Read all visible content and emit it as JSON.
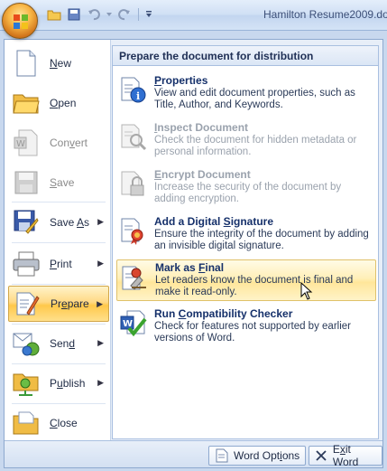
{
  "window": {
    "document_title": "Hamilton Resume2009.do"
  },
  "quick_access": {
    "icons": [
      "open-folder-icon",
      "save-icon",
      "undo-icon",
      "dropdown-icon",
      "redo-icon",
      "customize-icon"
    ]
  },
  "office_menu": {
    "commands": [
      {
        "key": "new",
        "label": "New",
        "accel": "N",
        "icon": "new-document-icon",
        "enabled": true,
        "submenu": false
      },
      {
        "key": "open",
        "label": "Open",
        "accel": "O",
        "icon": "open-folder-icon",
        "enabled": true,
        "submenu": false
      },
      {
        "key": "convert",
        "label": "Convert",
        "accel": "v",
        "icon": "convert-icon",
        "enabled": false,
        "submenu": false
      },
      {
        "key": "save",
        "label": "Save",
        "accel": "S",
        "icon": "save-icon",
        "enabled": false,
        "submenu": false
      },
      {
        "key": "save-as",
        "label": "Save As",
        "accel": "A",
        "icon": "save-as-icon",
        "enabled": true,
        "submenu": true
      },
      {
        "key": "print",
        "label": "Print",
        "accel": "P",
        "icon": "printer-icon",
        "enabled": true,
        "submenu": true
      },
      {
        "key": "prepare",
        "label": "Prepare",
        "accel": "E",
        "icon": "prepare-icon",
        "enabled": true,
        "submenu": true,
        "active": true
      },
      {
        "key": "send",
        "label": "Send",
        "accel": "D",
        "icon": "send-icon",
        "enabled": true,
        "submenu": true
      },
      {
        "key": "publish",
        "label": "Publish",
        "accel": "U",
        "icon": "publish-icon",
        "enabled": true,
        "submenu": true
      },
      {
        "key": "close",
        "label": "Close",
        "accel": "C",
        "icon": "close-folder-icon",
        "enabled": true,
        "submenu": false
      }
    ],
    "label_parts": {
      "new": {
        "pre": "",
        "u": "N",
        "post": "ew"
      },
      "open": {
        "pre": "",
        "u": "O",
        "post": "pen"
      },
      "convert": {
        "pre": "Con",
        "u": "v",
        "post": "ert"
      },
      "save": {
        "pre": "",
        "u": "S",
        "post": "ave"
      },
      "save_as": {
        "pre": "Save ",
        "u": "A",
        "post": "s"
      },
      "print": {
        "pre": "",
        "u": "P",
        "post": "rint"
      },
      "prepare": {
        "pre": "Pr",
        "u": "e",
        "post": "pare"
      },
      "send": {
        "pre": "Sen",
        "u": "d",
        "post": ""
      },
      "publish": {
        "pre": "P",
        "u": "u",
        "post": "blish"
      },
      "close": {
        "pre": "",
        "u": "C",
        "post": "lose"
      }
    }
  },
  "prepare_submenu": {
    "header": "Prepare the document for distribution",
    "items": [
      {
        "title_pre": "",
        "title_u": "P",
        "title_post": "roperties",
        "description": "View and edit document properties, such as Title, Author, and Keywords.",
        "icon": "properties-icon",
        "enabled": true
      },
      {
        "title_pre": "",
        "title_u": "I",
        "title_post": "nspect Document",
        "description": "Check the document for hidden metadata or personal information.",
        "icon": "inspect-document-icon",
        "enabled": false
      },
      {
        "title_pre": "",
        "title_u": "E",
        "title_post": "ncrypt Document",
        "description": "Increase the security of the document by adding encryption.",
        "icon": "encrypt-lock-icon",
        "enabled": false
      },
      {
        "title_pre": "Add a Digital ",
        "title_u": "S",
        "title_post": "ignature",
        "description": "Ensure the integrity of the document by adding an invisible digital signature.",
        "icon": "digital-signature-icon",
        "enabled": true
      },
      {
        "title_pre": "Mark as ",
        "title_u": "F",
        "title_post": "inal",
        "description": "Let readers know the document is final and make it read-only.",
        "icon": "mark-final-icon",
        "enabled": true,
        "hover": true
      },
      {
        "title_pre": "Run ",
        "title_u": "C",
        "title_post": "ompatibility Checker",
        "description": "Check for features not supported by earlier versions of Word.",
        "icon": "compatibility-checker-icon",
        "enabled": true
      }
    ]
  },
  "footer": {
    "word_options_pre": "Word Opt",
    "word_options_u": "i",
    "word_options_post": "ons",
    "exit_pre": "E",
    "exit_u": "x",
    "exit_post": "it Word"
  }
}
